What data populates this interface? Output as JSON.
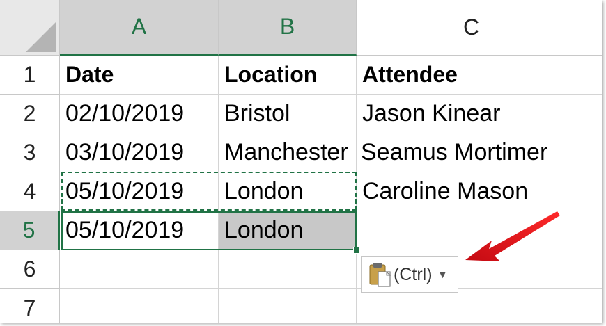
{
  "columns": [
    "A",
    "B",
    "C"
  ],
  "rows": [
    "1",
    "2",
    "3",
    "4",
    "5",
    "6",
    "7"
  ],
  "table": {
    "headers": [
      "Date",
      "Location",
      "Attendee"
    ],
    "data": [
      [
        "02/10/2019",
        "Bristol",
        "Jason Kinear"
      ],
      [
        "03/10/2019",
        "Manchester",
        "Seamus Mortimer"
      ],
      [
        "05/10/2019",
        "London",
        "Caroline Mason"
      ],
      [
        "05/10/2019",
        "London",
        ""
      ]
    ]
  },
  "paste_options": {
    "label": "(Ctrl)"
  },
  "colors": {
    "excel_green": "#217346",
    "header_active_bg": "#d2d2d2",
    "arrow_red": "#e8141c"
  },
  "icons": [
    "clipboard-paste-icon",
    "dropdown-caret-icon",
    "select-all-triangle-icon",
    "red-arrow"
  ]
}
